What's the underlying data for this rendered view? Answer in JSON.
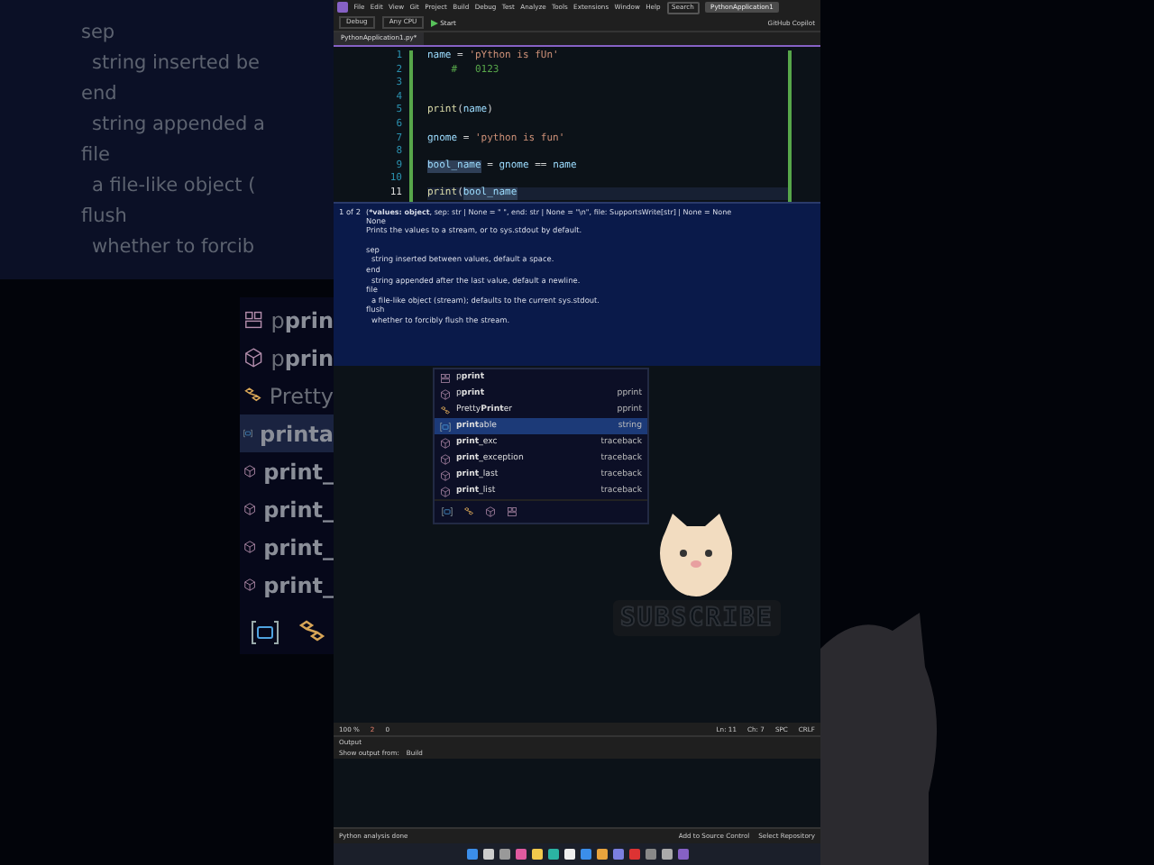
{
  "backdrop": {
    "doc_lines": [
      {
        "text": "sep",
        "kind": "term"
      },
      {
        "text": "string inserted be",
        "kind": "desc"
      },
      {
        "text": "end",
        "kind": "term"
      },
      {
        "text": "string appended a",
        "kind": "desc"
      },
      {
        "text": "file",
        "kind": "term"
      },
      {
        "text": "a file-like object (",
        "kind": "desc"
      },
      {
        "text": "flush",
        "kind": "term"
      },
      {
        "text": "whether to forcib",
        "kind": "desc"
      }
    ],
    "completions": [
      {
        "text": "p**prin**",
        "kind": "module",
        "selected": false
      },
      {
        "text": "p**prin**",
        "kind": "function",
        "selected": false
      },
      {
        "text": "Pretty",
        "kind": "class",
        "selected": false
      },
      {
        "text": "**printa**",
        "kind": "variable",
        "selected": true
      },
      {
        "text": "**print_**",
        "kind": "function",
        "selected": false
      },
      {
        "text": "**print_**",
        "kind": "function",
        "selected": false
      },
      {
        "text": "**print_**",
        "kind": "function",
        "selected": false
      },
      {
        "text": "**print_**",
        "kind": "function",
        "selected": false
      }
    ]
  },
  "ide": {
    "menu": [
      "File",
      "Edit",
      "View",
      "Git",
      "Project",
      "Build",
      "Debug",
      "Test",
      "Analyze",
      "Tools",
      "Extensions",
      "Window",
      "Help"
    ],
    "search": "Search",
    "solution": "PythonApplication1",
    "toolbar": {
      "configuration": "Debug",
      "platform": "Any CPU",
      "start": "Start",
      "copilot": "GitHub Copilot"
    },
    "tab": {
      "title": "PythonApplication1.py*"
    },
    "code": [
      {
        "number": "1",
        "current": false,
        "tokens": [
          {
            "text": "name",
            "kind": "var"
          },
          {
            "text": " = ",
            "kind": "op"
          },
          {
            "text": "'pYthon is fUn'",
            "kind": "str"
          }
        ]
      },
      {
        "number": "2",
        "current": false,
        "tokens": [
          {
            "text": "    #   0123",
            "kind": "comment"
          }
        ]
      },
      {
        "number": "3",
        "current": false
      },
      {
        "number": "4",
        "current": false
      },
      {
        "number": "5",
        "current": false,
        "tokens": [
          {
            "text": "print",
            "kind": "func"
          },
          {
            "text": "(",
            "kind": "op"
          },
          {
            "text": "name",
            "kind": "var"
          },
          {
            "text": ")",
            "kind": "op"
          }
        ]
      },
      {
        "number": "6",
        "current": false
      },
      {
        "number": "7",
        "current": false,
        "tokens": [
          {
            "text": "gnome",
            "kind": "var"
          },
          {
            "text": " = ",
            "kind": "op"
          },
          {
            "text": "'python is fun'",
            "kind": "str"
          }
        ]
      },
      {
        "number": "8",
        "current": false
      },
      {
        "number": "9",
        "current": false,
        "tokens": [
          {
            "text": "bool_name",
            "kind": "ref"
          },
          {
            "text": " = ",
            "kind": "op"
          },
          {
            "text": "gnome",
            "kind": "var"
          },
          {
            "text": " == ",
            "kind": "op"
          },
          {
            "text": "name",
            "kind": "var"
          }
        ]
      },
      {
        "number": "10",
        "current": false
      },
      {
        "number": "11",
        "current": true,
        "tokens": [
          {
            "text": "print",
            "kind": "func"
          },
          {
            "text": "(",
            "kind": "op"
          },
          {
            "text": "bool_name",
            "kind": "ref"
          }
        ]
      }
    ],
    "tooltip": {
      "counter": "1 of 2",
      "signature": "(***values: object**, sep: str | None = \" \", end: str | None = \"\\n\", file: SupportsWrite[str] | None = None",
      "returns": "None",
      "summary": "Prints the values to a stream, or to sys.stdout by default.",
      "params": [
        {
          "name": "sep",
          "desc": "string inserted between values, default a space."
        },
        {
          "name": "end",
          "desc": "string appended after the last value, default a newline."
        },
        {
          "name": "file",
          "desc": "a file-like object (stream); defaults to the current sys.stdout."
        },
        {
          "name": "flush",
          "desc": "whether to forcibly flush the stream."
        }
      ]
    },
    "completion": {
      "items": [
        {
          "name": "p**print**",
          "kind": "module",
          "selected": false
        },
        {
          "name": "p**print**",
          "source": "pprint",
          "kind": "function",
          "selected": false
        },
        {
          "name": "Pretty**Print**er",
          "source": "pprint",
          "kind": "class",
          "selected": false
        },
        {
          "name": "**print**able",
          "source": "string",
          "kind": "variable",
          "selected": true
        },
        {
          "name": "**print**_exc",
          "source": "traceback",
          "kind": "function",
          "selected": false
        },
        {
          "name": "**print**_exception",
          "source": "traceback",
          "kind": "function",
          "selected": false
        },
        {
          "name": "**print**_last",
          "source": "traceback",
          "kind": "function",
          "selected": false
        },
        {
          "name": "**print**_list",
          "source": "traceback",
          "kind": "function",
          "selected": false
        }
      ]
    },
    "editor_status": {
      "zoom": "100 %",
      "errors": "2",
      "warnings": "0",
      "line": "Ln: 11",
      "column": "Ch: 7",
      "indent": "SPC",
      "line_ending": "CRLF"
    },
    "output": {
      "title": "Output",
      "source_label": "Show output from:",
      "source": "Build"
    },
    "status_bar": {
      "message": "Python analysis done",
      "source_control": "Add to Source Control",
      "repository": "Select Repository"
    },
    "sticker": {
      "text": "SUBSCRIBE"
    }
  }
}
